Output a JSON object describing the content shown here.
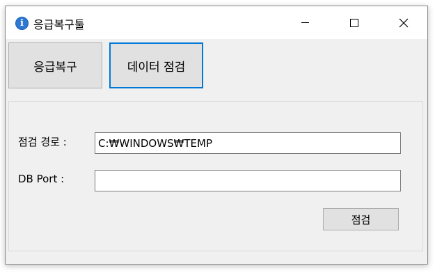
{
  "window": {
    "title": "응급복구툴",
    "icon": "info-icon",
    "icon_glyph": "i"
  },
  "tabs": [
    {
      "label": "응급복구",
      "selected": false
    },
    {
      "label": "데이터 점검",
      "selected": true
    }
  ],
  "form": {
    "path_label": "점검 경로 :",
    "path_value": "C:₩WINDOWS₩TEMP",
    "port_label": "DB Port :",
    "port_value": "",
    "check_button": "점검"
  },
  "colors": {
    "focus_border": "#0078d7",
    "button_bg": "#e1e1e1",
    "window_bg": "#f0f0f0"
  }
}
